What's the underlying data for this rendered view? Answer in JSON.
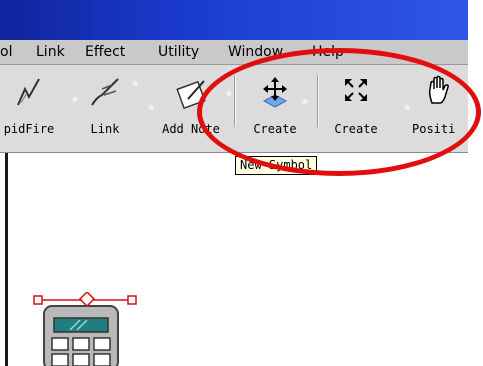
{
  "menu": {
    "items": [
      "ol",
      "Link",
      "Effect",
      "Utility",
      "Window",
      "Help"
    ]
  },
  "toolbar": {
    "tools": [
      {
        "label": "pidFire",
        "icon": "rapidfire-pen-icon"
      },
      {
        "label": "Link",
        "icon": "link-icon"
      },
      {
        "label": "Add Note",
        "icon": "add-note-icon"
      },
      {
        "label": "Create",
        "icon": "create-move-arrows-icon"
      },
      {
        "label": "Create",
        "icon": "create-expand-arrows-icon"
      },
      {
        "label": "Positi",
        "icon": "hand-icon"
      }
    ]
  },
  "tooltip": {
    "text": "New Symbol"
  },
  "colors": {
    "titlebar": "#1b3bcf",
    "highlight": "#e20d0d",
    "tooltip_bg": "#ffffe1"
  }
}
